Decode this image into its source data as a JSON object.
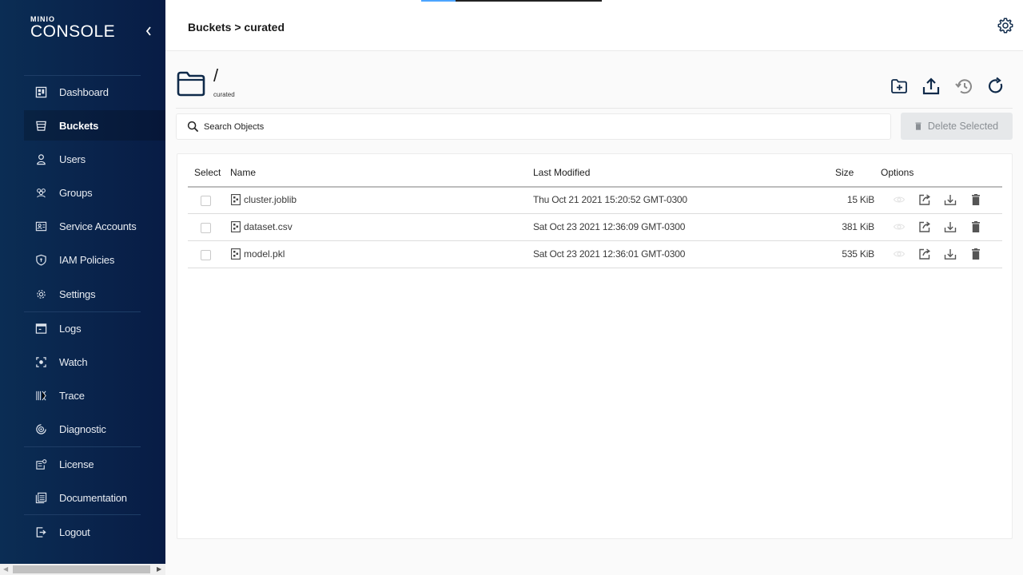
{
  "app": {
    "brand_small": "MINIO",
    "brand_large": "CONSOLE"
  },
  "colors": {
    "sidebar_start": "#0b2d54",
    "sidebar_end": "#081c45",
    "accent": "#4ca5ff",
    "icon_dark": "#0f2a4a",
    "delete_disabled_bg": "#e6e8ea"
  },
  "sidebar": {
    "items": [
      {
        "label": "Dashboard",
        "icon": "dashboard-icon",
        "active": false
      },
      {
        "label": "Buckets",
        "icon": "bucket-icon",
        "active": true
      },
      {
        "label": "Users",
        "icon": "user-icon",
        "active": false
      },
      {
        "label": "Groups",
        "icon": "groups-icon",
        "active": false
      },
      {
        "label": "Service Accounts",
        "icon": "service-accounts-icon",
        "active": false
      },
      {
        "label": "IAM Policies",
        "icon": "shield-icon",
        "active": false
      },
      {
        "label": "Settings",
        "icon": "gear-icon",
        "active": false
      },
      {
        "label": "Logs",
        "icon": "logs-icon",
        "active": false
      },
      {
        "label": "Watch",
        "icon": "watch-icon",
        "active": false
      },
      {
        "label": "Trace",
        "icon": "trace-icon",
        "active": false
      },
      {
        "label": "Diagnostic",
        "icon": "diagnostic-icon",
        "active": false
      },
      {
        "label": "License",
        "icon": "license-icon",
        "active": false
      },
      {
        "label": "Documentation",
        "icon": "documentation-icon",
        "active": false
      },
      {
        "label": "Logout",
        "icon": "logout-icon",
        "active": false
      }
    ]
  },
  "header": {
    "breadcrumb": "Buckets > curated",
    "progress_percent": 19
  },
  "object_browser": {
    "path": "/",
    "bucket": "curated",
    "actions": [
      "create-folder",
      "upload",
      "rewind",
      "refresh"
    ],
    "search_placeholder": "Search Objects",
    "search_value": "",
    "delete_selected_label": "Delete Selected"
  },
  "table": {
    "columns": [
      "Select",
      "Name",
      "Last Modified",
      "Size",
      "Options"
    ],
    "rows": [
      {
        "name": "cluster.joblib",
        "last_modified": "Thu Oct 21 2021 15:20:52 GMT-0300",
        "size": "15 KiB",
        "selected": false
      },
      {
        "name": "dataset.csv",
        "last_modified": "Sat Oct 23 2021 12:36:09 GMT-0300",
        "size": "381 KiB",
        "selected": false
      },
      {
        "name": "model.pkl",
        "last_modified": "Sat Oct 23 2021 12:36:01 GMT-0300",
        "size": "535 KiB",
        "selected": false
      }
    ]
  }
}
